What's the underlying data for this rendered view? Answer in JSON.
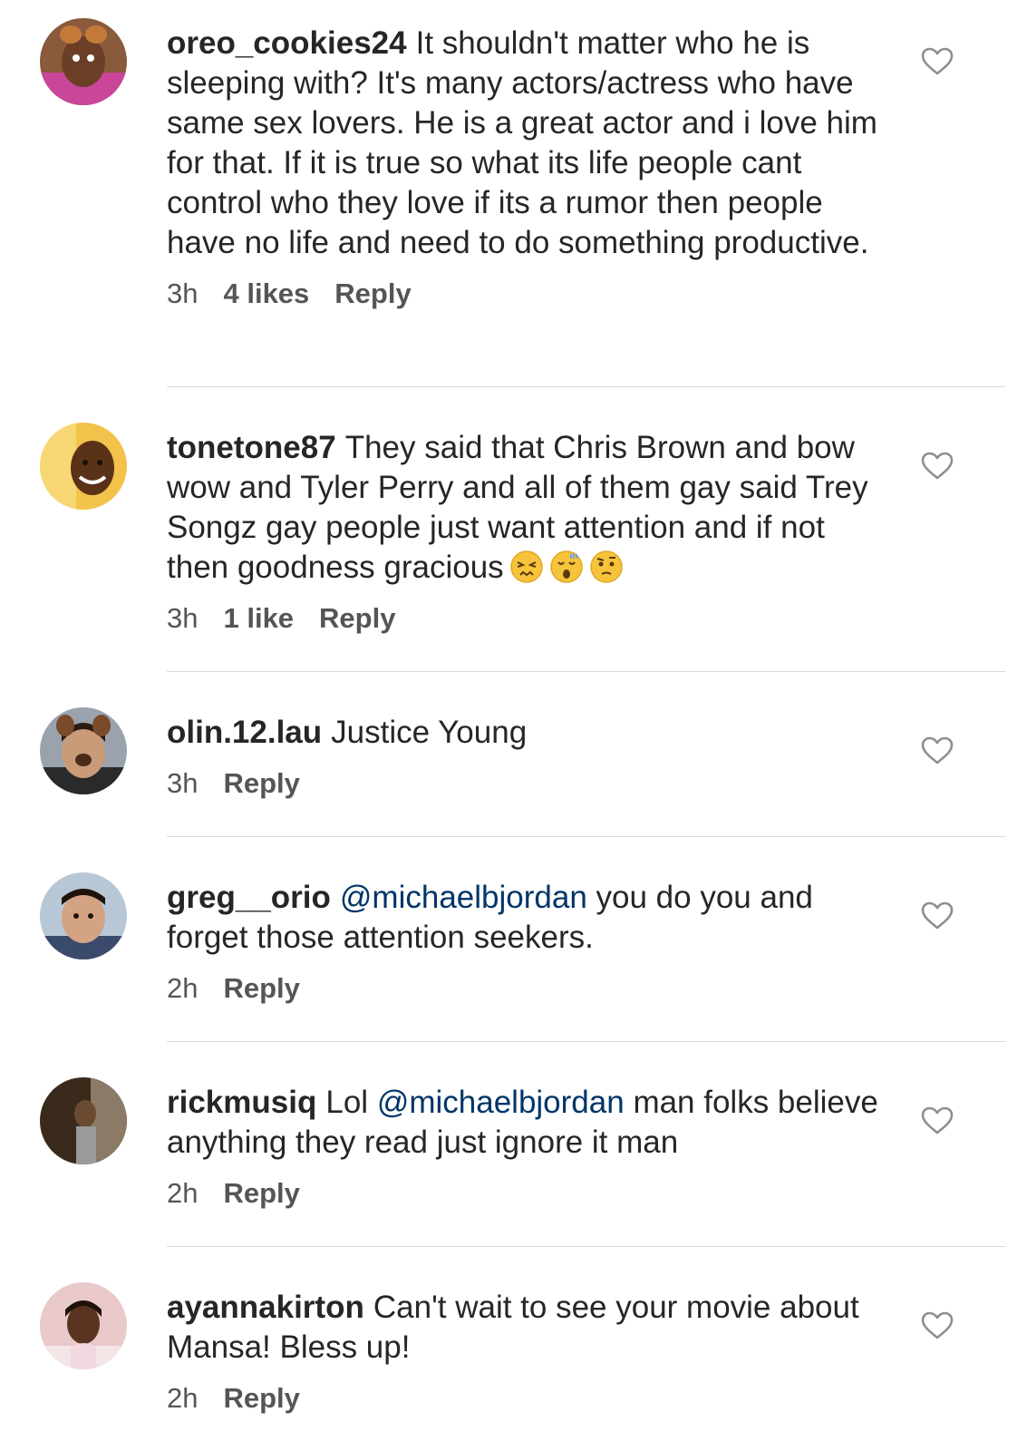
{
  "comments": [
    {
      "username": "oreo_cookies24",
      "text": "It shouldn't matter who he is sleeping with? It's many actors/actress who have same sex lovers. He is a great actor and i love him for that. If it is true so what its life people cant control who they love if its a rumor then people have no life and need to do something productive.",
      "time": "3h",
      "likes": "4 likes",
      "reply": "Reply",
      "avatar_icon": "user-avatar-icon"
    },
    {
      "username": "tonetone87",
      "text": "They said that Chris Brown and bow wow and Tyler Perry and all of them gay said Trey Songz gay people just want attention and if not then goodness gracious",
      "emojis": [
        "😣",
        "😲",
        "🤨"
      ],
      "time": "3h",
      "likes": "1 like",
      "reply": "Reply",
      "avatar_icon": "user-avatar-icon"
    },
    {
      "username": "olin.12.lau",
      "text": "Justice Young",
      "time": "3h",
      "reply": "Reply",
      "avatar_icon": "user-avatar-icon"
    },
    {
      "username": "greg__orio",
      "mention": "@michaelbjordan",
      "text_before": "",
      "text_after": "you do you and forget those attention seekers.",
      "time": "2h",
      "reply": "Reply",
      "avatar_icon": "user-avatar-icon"
    },
    {
      "username": "rickmusiq",
      "text_before": "Lol",
      "mention": "@michaelbjordan",
      "text_after": "man folks believe anything they read just ignore it man",
      "time": "2h",
      "reply": "Reply",
      "avatar_icon": "user-avatar-icon"
    },
    {
      "username": "ayannakirton",
      "text": "Can't wait to see your movie about Mansa! Bless up!",
      "time": "2h",
      "reply": "Reply",
      "avatar_icon": "user-avatar-icon"
    }
  ],
  "icons": {
    "like": "heart-outline-icon"
  },
  "colors": {
    "text": "#262626",
    "meta": "#555555",
    "mention": "#003569",
    "divider": "#dbdbdb",
    "heart": "#8e8e8e"
  }
}
